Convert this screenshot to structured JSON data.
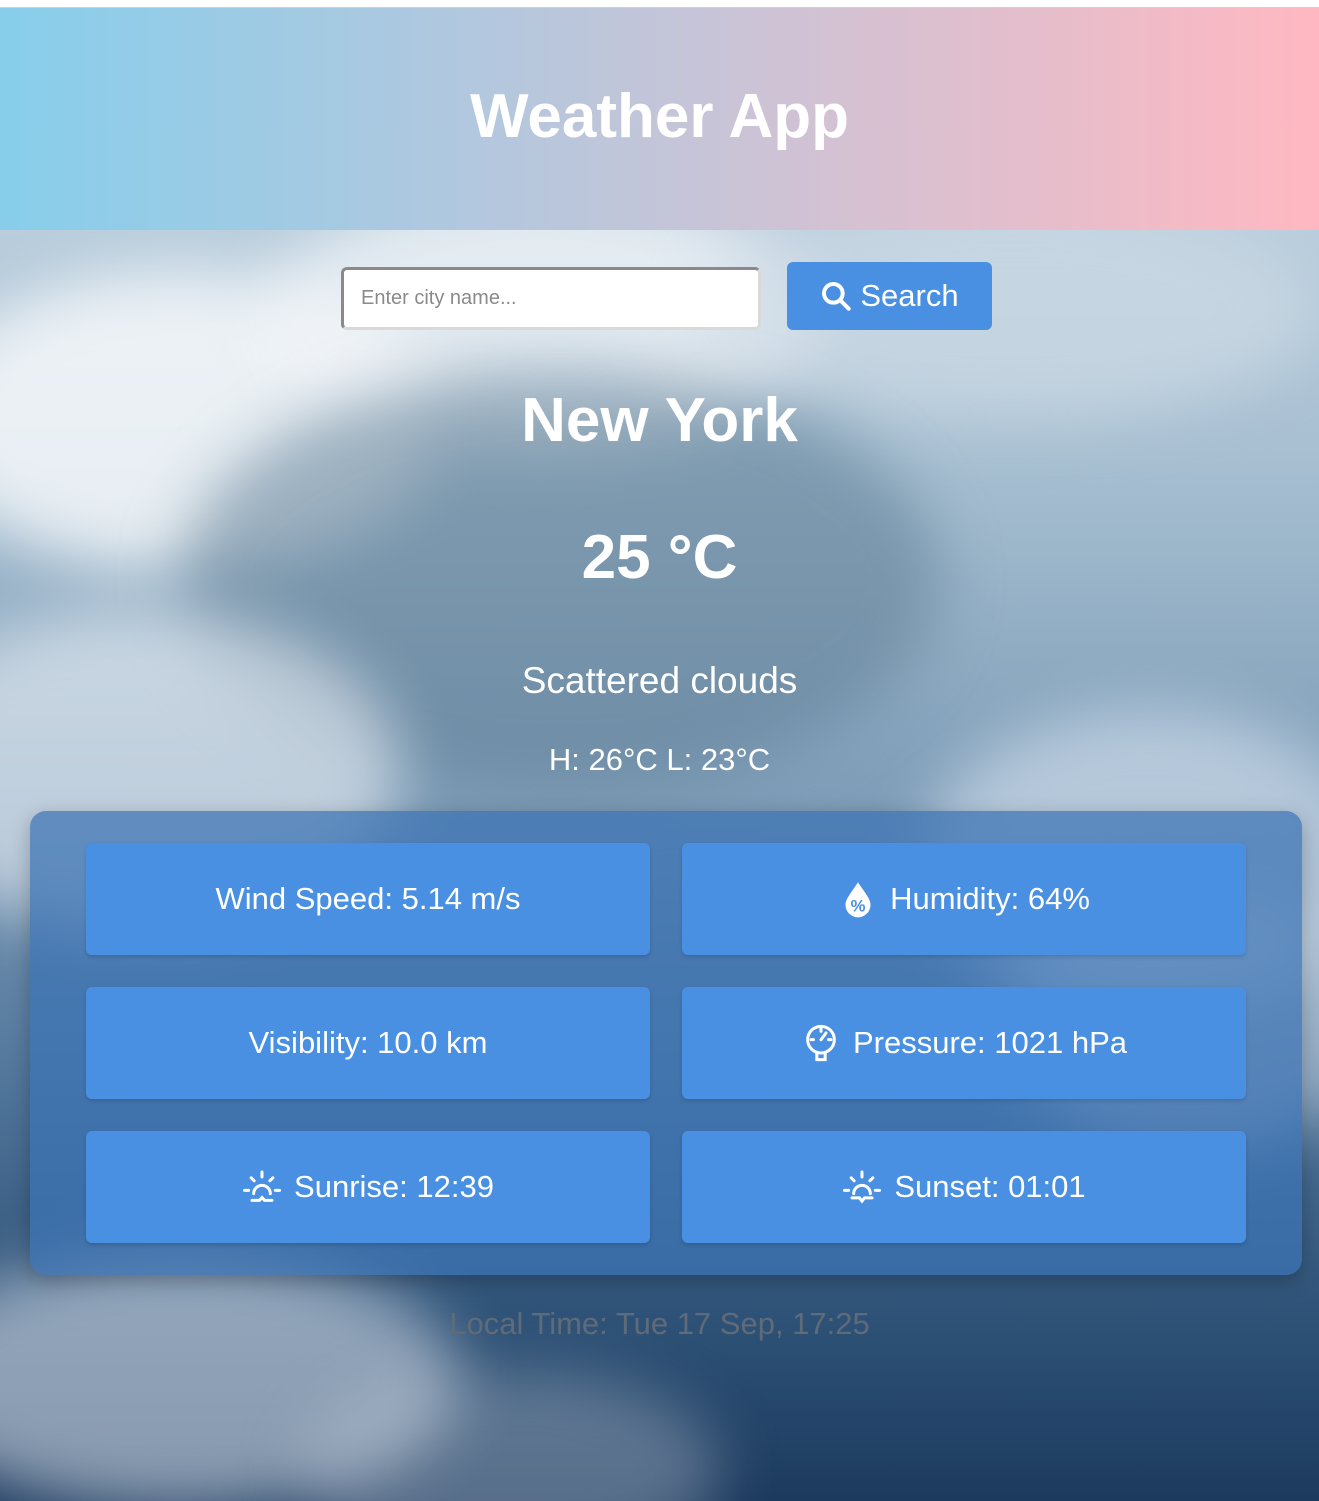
{
  "header": {
    "title": "Weather App"
  },
  "search": {
    "placeholder": "Enter city name...",
    "value": "",
    "button_label": "Search",
    "button_icon": "search-icon"
  },
  "weather": {
    "city": "New York",
    "temperature": "25 °C",
    "description": "Scattered clouds",
    "high_low": "H: 26°C L: 23°C"
  },
  "details": {
    "wind": "Wind Speed: 5.14 m/s",
    "humidity": "Humidity: 64%",
    "visibility": "Visibility: 10.0 km",
    "pressure": "Pressure: 1021 hPa",
    "sunrise": "Sunrise: 12:39",
    "sunset": "Sunset: 01:01"
  },
  "local_time": "Local Time: Tue 17 Sep, 17:25",
  "colors": {
    "accent": "#4a90e2",
    "header_gradient_start": "#87ceeb",
    "header_gradient_end": "#ffb8c1",
    "panel": "#3c73b4",
    "local_time_text": "#5f6b78"
  }
}
